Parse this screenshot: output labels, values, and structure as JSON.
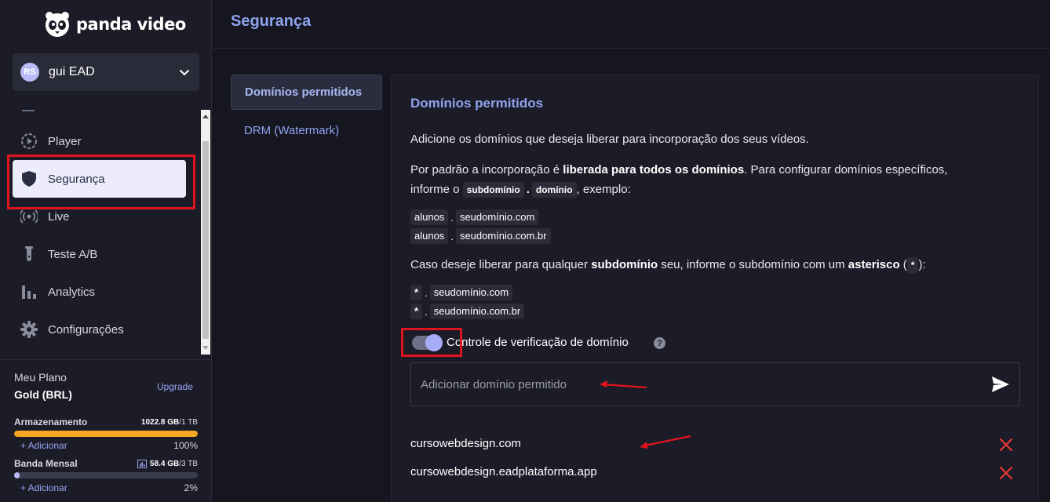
{
  "app": {
    "brand": "panda video"
  },
  "account": {
    "initials": "RS",
    "name": "gui EAD"
  },
  "sidebar": {
    "items": [
      {
        "label": "Player",
        "icon": "play-circle-icon"
      },
      {
        "label": "Segurança",
        "icon": "shield-icon",
        "active": true
      },
      {
        "label": "Live",
        "icon": "broadcast-icon"
      },
      {
        "label": "Teste A/B",
        "icon": "test-tube-icon"
      },
      {
        "label": "Analytics",
        "icon": "bar-chart-icon"
      },
      {
        "label": "Configurações",
        "icon": "gear-icon"
      }
    ]
  },
  "plan": {
    "title": "Meu Plano",
    "name": "Gold (BRL)",
    "upgrade": "Upgrade",
    "storage": {
      "label": "Armazenamento",
      "used": "1022.8 GB",
      "total": "/1 TB",
      "add": "+ Adicionar",
      "percent": "100%",
      "fill": 100,
      "color": "#f5a623"
    },
    "bandwidth": {
      "label": "Banda Mensal",
      "used": "58.4 GB",
      "total": "/3 TB",
      "add": "+ Adicionar",
      "percent": "2%",
      "fill": 2,
      "color": "#b9bcf7"
    }
  },
  "header": {
    "title": "Segurança"
  },
  "tabs": [
    {
      "label": "Domínios permitidos",
      "active": true
    },
    {
      "label": "DRM (Watermark)"
    }
  ],
  "card": {
    "title": "Domínios permitidos",
    "intro": "Adicione os domínios que deseja liberar para incorporação dos seus vídeos.",
    "p2_a": "Por padrão a incorporação é ",
    "p2_b": "liberada para todos os domínios",
    "p2_c": ". Para configurar domínios específicos,",
    "p2_d": "informe o ",
    "code_sub": "subdomínio",
    "dot": ".",
    "code_dom": "domínio",
    "p2_e": ", exemplo:",
    "ex1": [
      "alunos",
      ".",
      "seudomínio.com"
    ],
    "ex2": [
      "alunos",
      ".",
      "seudomínio.com.br"
    ],
    "p3_a": "Caso deseje liberar para qualquer ",
    "p3_b": "subdomínio",
    "p3_c": " seu, informe o subdomínio com um ",
    "p3_d": "asterisco",
    "p3_e": " (",
    "p3_star": "*",
    "p3_f": "):",
    "ex3": [
      "*",
      ".",
      "seudomínio.com"
    ],
    "ex4": [
      "*",
      ".",
      "seudomínio.com.br"
    ],
    "toggle_label": "Controle de verificação de domínio",
    "toggle_on": true,
    "help": "?",
    "input_placeholder": "Adicionar domínio permitido",
    "input_value": "",
    "domains": [
      "cursowebdesign.com",
      "cursowebdesign.eadplataforma.app"
    ]
  },
  "colors": {
    "accent": "#8fa3ee",
    "annotation": "#e0141e",
    "delete": "#e53935"
  }
}
